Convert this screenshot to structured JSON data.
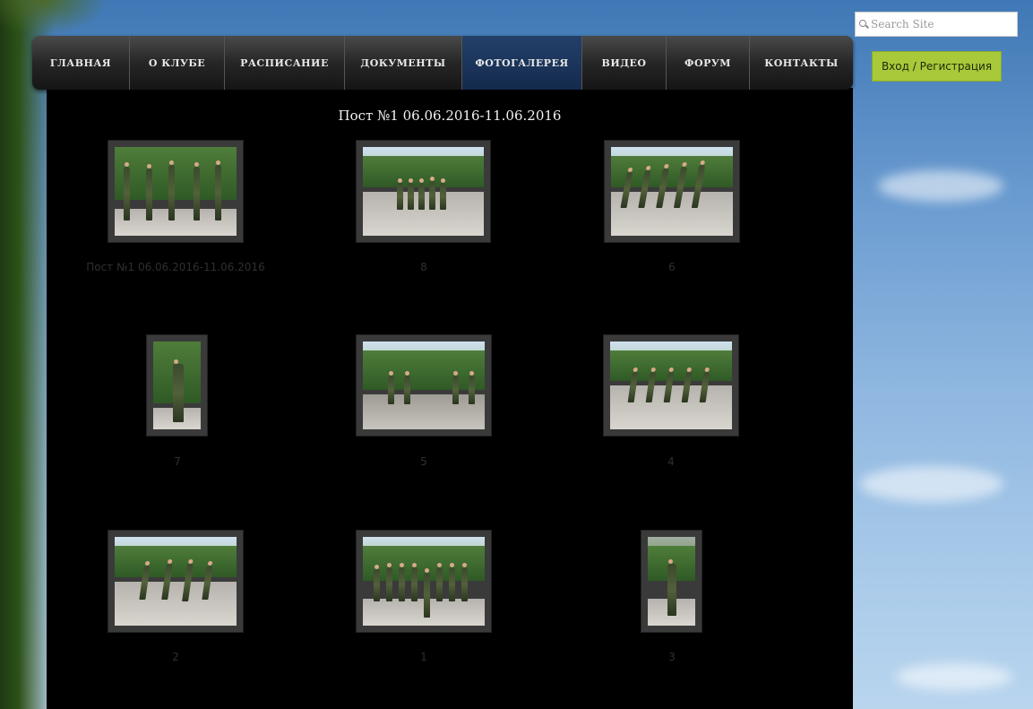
{
  "nav": {
    "items": [
      {
        "label": "ГЛАВНАЯ",
        "active": false
      },
      {
        "label": "О КЛУБЕ",
        "active": false
      },
      {
        "label": "РАСПИСАНИЕ",
        "active": false
      },
      {
        "label": "ДОКУМЕНТЫ",
        "active": false
      },
      {
        "label": "ФОТОГАЛЕРЕЯ",
        "active": true
      },
      {
        "label": "ВИДЕО",
        "active": false
      },
      {
        "label": "ФОРУМ",
        "active": false
      },
      {
        "label": "КОНТАКТЫ",
        "active": false
      }
    ]
  },
  "search": {
    "placeholder": "Search Site"
  },
  "login": {
    "label": "Вход / Регистрация"
  },
  "gallery": {
    "title": "Пост №1 06.06.2016-11.06.2016",
    "items": [
      {
        "caption": "Пост №1 06.06.2016-11.06.2016"
      },
      {
        "caption": "8"
      },
      {
        "caption": "6"
      },
      {
        "caption": "7"
      },
      {
        "caption": "5"
      },
      {
        "caption": "4"
      },
      {
        "caption": "2"
      },
      {
        "caption": "1"
      },
      {
        "caption": "3"
      }
    ]
  },
  "colors": {
    "accent": "#a8c93a",
    "active_nav": "#1b3558",
    "panel": "#000000"
  },
  "icons": {
    "search": "search-icon"
  }
}
